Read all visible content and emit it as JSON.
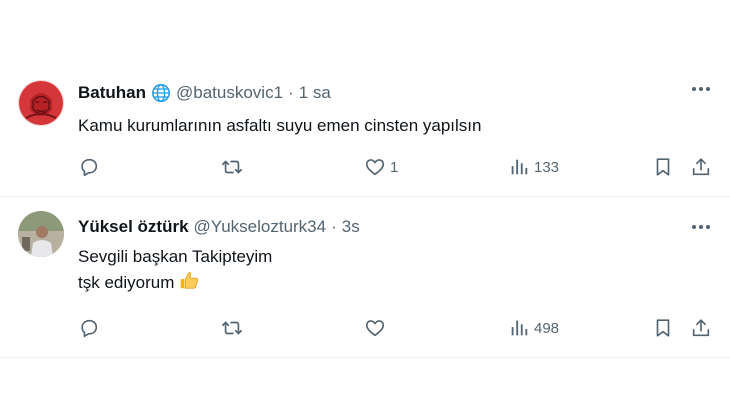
{
  "tweets": [
    {
      "name": "Batuhan",
      "handle": "@batuskovic1",
      "separator": "·",
      "time": "1 sa",
      "lines": [
        "Kamu kurumlarının asfaltı suyu emen cinsten yapılsın"
      ],
      "likes": "1",
      "views": "133"
    },
    {
      "name": "Yüksel öztürk",
      "handle": "@Yukselozturk34",
      "separator": "·",
      "time": "3s",
      "lines": [
        "Sevgili başkan Takipteyim",
        "tşk ediyorum"
      ],
      "likes": "",
      "views": "498"
    }
  ],
  "icons": {
    "verified": "globe-icon",
    "reply": "reply-icon",
    "retweet": "retweet-icon",
    "like": "heart-icon",
    "views": "views-icon",
    "bookmark": "bookmark-icon",
    "share": "share-icon",
    "more": "more-icon",
    "emoji": "thumbs-up-emoji"
  },
  "colors": {
    "text": "#0f1419",
    "secondary": "#536471",
    "divider": "#eff3f4",
    "globe": "#1d9bf0",
    "avatar1": "#d4363a"
  }
}
